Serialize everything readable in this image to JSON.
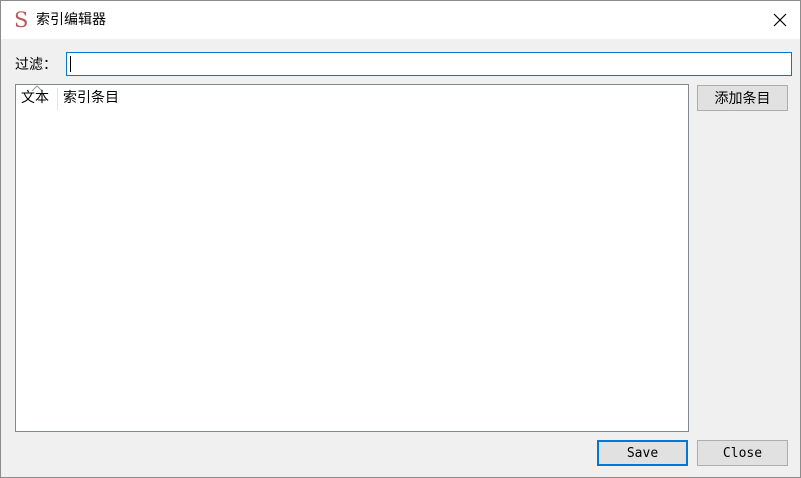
{
  "window": {
    "title": "索引编辑器",
    "app_icon_glyph": "S",
    "app_icon_color": "#b5595c",
    "close_icon": "close-icon"
  },
  "filter": {
    "label": "过滤：",
    "value": "",
    "placeholder": "",
    "focus_color": "#0078d7"
  },
  "table": {
    "columns": [
      {
        "label": "文本"
      },
      {
        "label": "索引条目"
      }
    ],
    "rows": []
  },
  "buttons": {
    "add_entry_label": "添加条目",
    "save_label": "Save",
    "close_label": "Close"
  }
}
